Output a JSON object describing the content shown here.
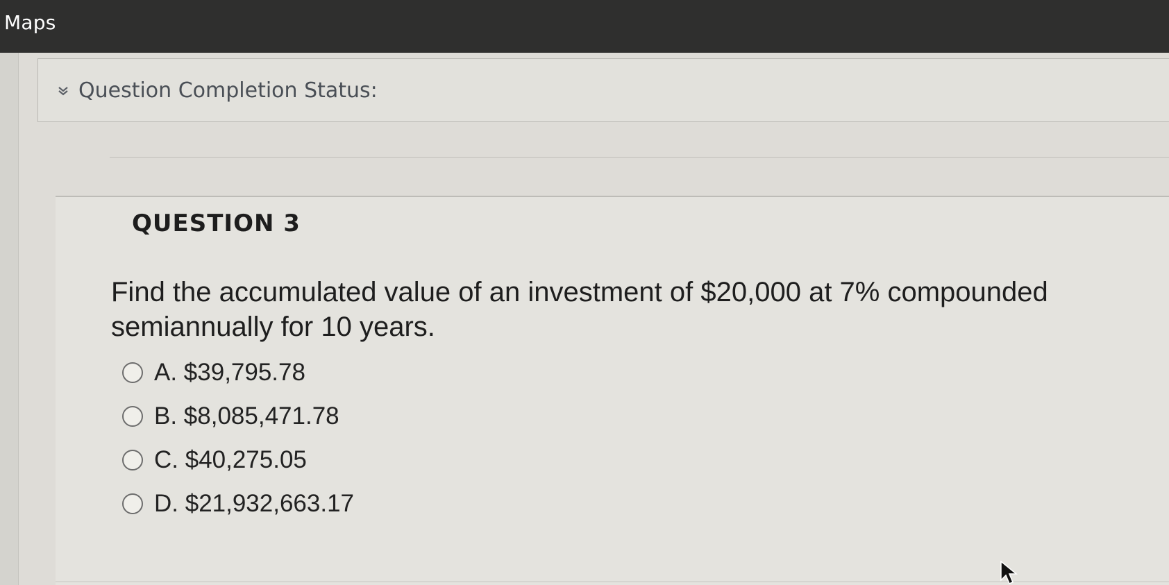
{
  "window": {
    "title": "Maps"
  },
  "status": {
    "label": "Question Completion Status:",
    "icon": "double-chevron-down-icon"
  },
  "question": {
    "heading": "QUESTION 3",
    "text": "Find the accumulated value of an investment of $20,000 at 7% compounded semiannually for 10 years.",
    "options": [
      {
        "label": "A. $39,795.78",
        "selected": false
      },
      {
        "label": "B. $8,085,471.78",
        "selected": false
      },
      {
        "label": "C. $40,275.05",
        "selected": false
      },
      {
        "label": "D. $21,932,663.17",
        "selected": false
      }
    ]
  },
  "colors": {
    "topbar": "#2f2f2e",
    "page": "#e4e3de",
    "text": "#1e1e1e",
    "status_text": "#4a4f56"
  }
}
